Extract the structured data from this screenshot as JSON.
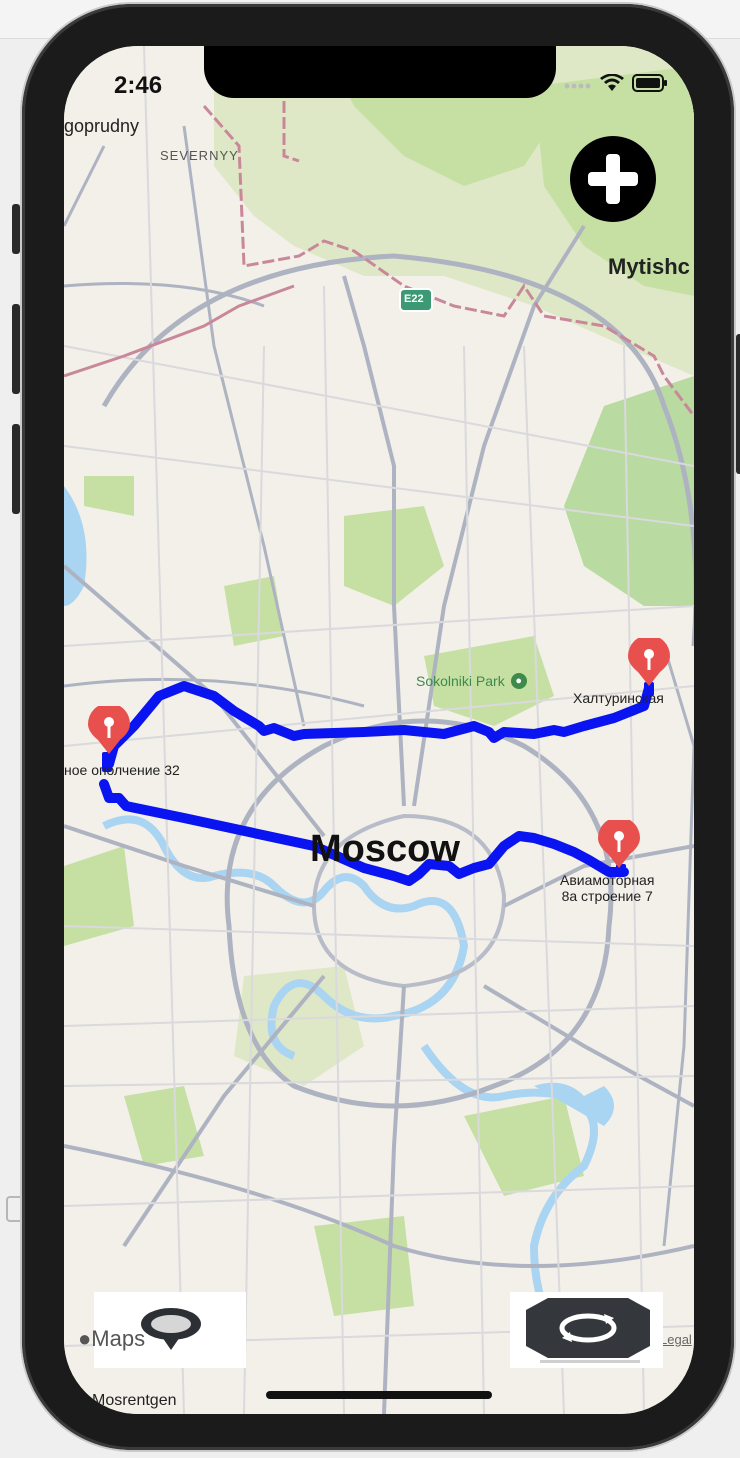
{
  "status_bar": {
    "time": "2:46"
  },
  "map": {
    "place_labels": {
      "dolgoprudny": "goprudny",
      "severnyy": "SEVERNYY",
      "mytishchi": "Mytishc",
      "highway_shield": "E22",
      "sokolniki_park": "Sokolniki Park",
      "city": "Moscow",
      "mosrentgen": "Mosrentgen"
    },
    "markers": [
      {
        "label": "ное ополчение 32"
      },
      {
        "label": "Халтуринская"
      },
      {
        "label": "Авиамоторная\n8а строение 7"
      }
    ],
    "route_color": "#0a14f0",
    "pin_color": "#e8504e",
    "legal": "Legal",
    "maps_logo": "Maps"
  },
  "controls": {
    "add_icon": "plus-icon",
    "location_icon": "location-pin-icon",
    "refresh_icon": "refresh-icon"
  }
}
